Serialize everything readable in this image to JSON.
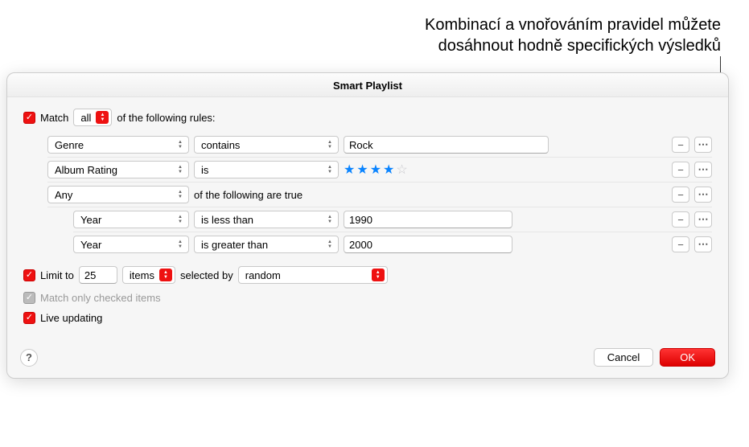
{
  "annotation": {
    "line1": "Kombinací a vnořováním pravidel můžete",
    "line2": "dosáhnout hodně specifických výsledků"
  },
  "dialog": {
    "title": "Smart Playlist",
    "match_prefix": "Match",
    "match_mode": "all",
    "match_suffix": "of the following rules:",
    "rules": [
      {
        "field": "Genre",
        "op": "contains",
        "value": "Rock"
      },
      {
        "field": "Album Rating",
        "op": "is",
        "stars": 4
      },
      {
        "group": "Any",
        "suffix": "of the following are true"
      },
      {
        "nested": true,
        "field": "Year",
        "op": "is less than",
        "value": "1990"
      },
      {
        "nested": true,
        "field": "Year",
        "op": "is greater than",
        "value": "2000"
      }
    ],
    "limit": {
      "label": "Limit to",
      "count": "25",
      "unit": "items",
      "selected_by_label": "selected by",
      "method": "random"
    },
    "match_checked_label": "Match only checked items",
    "live_updating_label": "Live updating",
    "buttons": {
      "help": "?",
      "cancel": "Cancel",
      "ok": "OK"
    }
  }
}
